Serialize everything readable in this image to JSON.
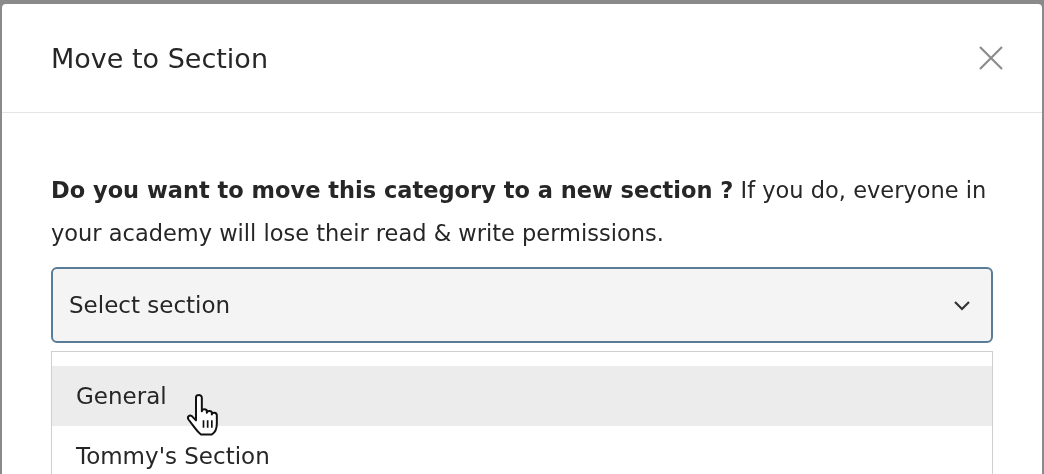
{
  "dialog": {
    "title": "Move to Section",
    "message": "**Do you want to move this category to a new section ?** If you do, everyone in your academy will lose their read & write permissions.",
    "select": {
      "placeholder": "Select section",
      "expanded": true
    },
    "options": [
      {
        "label": "General",
        "highlighted": true
      },
      {
        "label": "Tommy's Section",
        "highlighted": false
      }
    ]
  }
}
